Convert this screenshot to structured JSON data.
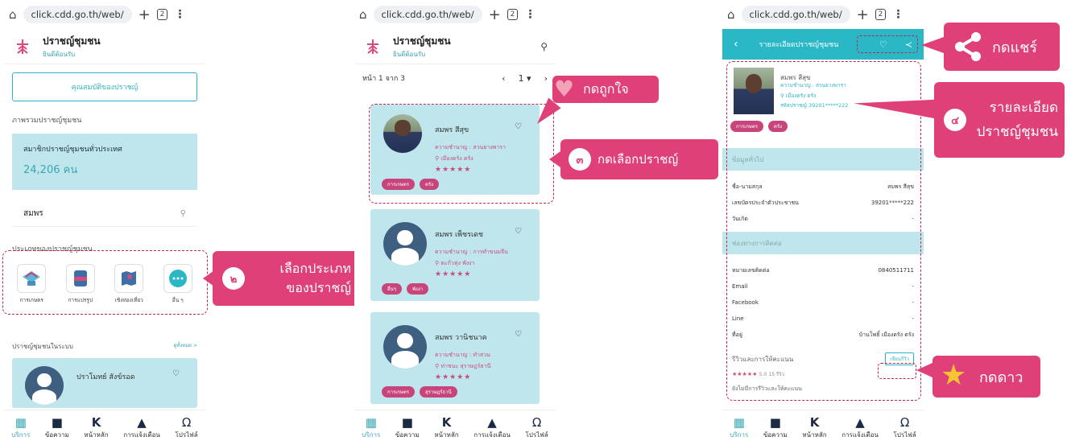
{
  "browser": {
    "url": "click.cdd.go.th/web/",
    "tab_count": "2"
  },
  "app": {
    "title": "ปราชญ์ชุมชน",
    "subtitle": "ยินดีต้อนรับ"
  },
  "nav": {
    "items": [
      "บริการ",
      "ข้อความ",
      "หน้าหลัก",
      "การแจ้งเตือน",
      "โปรไฟล์"
    ]
  },
  "screen1": {
    "qual_button": "คุณสมบัติของปราชญ์",
    "overview_title": "ภาพรวมปราชญ์ชุมชน",
    "stat_label": "สมาชิกปราชญ์ชุมชนทั่วประเทศ",
    "stat_value": "24,206 คน",
    "search_value": "สมพร",
    "types_title": "ประเภทของปราชญ์ชุมชน",
    "categories": [
      "การเกษตร",
      "การแปรรูป",
      "เชิงท่องเที่ยว",
      "อื่น ๆ"
    ],
    "in_system_title": "ปราชญ์ชุมชนในระบบ",
    "see_all": "ดูทั้งหมด >",
    "card_name": "ปราโมทย์ สังข์รอด"
  },
  "screen2": {
    "page_text": "หน้า 1 จาก 3",
    "page_select": "1",
    "cards": [
      {
        "name": "สมพร สีสุข",
        "skill": "ความชำนาญ : สวนยางพารา",
        "location": "เมืองตรัง ตรัง",
        "stars": "★★★★★",
        "tags": [
          "การเกษตร",
          "ตรัง"
        ]
      },
      {
        "name": "สมพร เพ็ชรเดช",
        "skill": "ความชำนาญ : การทำขนมจีน",
        "location": "ตะกั่วทุ่ง พังงา",
        "stars": "★★★★★",
        "tags": [
          "อื่นๆ",
          "พังงา"
        ]
      },
      {
        "name": "สมพร วานิชนาค",
        "skill": "ความชำนาญ : ทำสวน",
        "location": "ท่าชนะ สุราษฎร์ธานี",
        "stars": "★★★★★",
        "tags": [
          "การเกษตร",
          "สุราษฎร์ธานี"
        ]
      }
    ]
  },
  "screen3": {
    "bar_title": "รายละเอียดปราชญ์ชุมชน",
    "name": "สมพร สีสุข",
    "skill": "ความชำนาญ : สวนยางพารา",
    "location": "เมืองตรัง ตรัง",
    "code": "รหัสปราชญ์ 39201*****222",
    "tags": [
      "การเกษตร",
      "ตรัง"
    ],
    "general_title": "ข้อมูลทั่วไป",
    "general": [
      {
        "k": "ชื่อ-นามสกุล",
        "v": "สมพร สีสุข"
      },
      {
        "k": "เลขบัตรประจำตัวประชาชน",
        "v": "39201*****222"
      },
      {
        "k": "วันเกิด",
        "v": "-"
      }
    ],
    "contact_title": "ช่องทางการติดต่อ",
    "contact": [
      {
        "k": "หมายเลขติดต่อ",
        "v": "0840511711"
      },
      {
        "k": "Email",
        "v": "-"
      },
      {
        "k": "Facebook",
        "v": "-"
      },
      {
        "k": "Line",
        "v": "-"
      },
      {
        "k": "ที่อยู่",
        "v": "บ้านโพธิ์ เมืองตรัง ตรัง"
      }
    ],
    "review_title": "รีวิวและการให้คะแนน",
    "review_button": "เขียนรีวิว",
    "rating_stars": "★★★★★",
    "rating_value": "5.0",
    "rating_count": "15 รีวิว",
    "bottom_cut": "ยังไม่มีการรีวิวและให้คะแนน"
  },
  "callouts": {
    "c2_num": "๒",
    "c2_line1": "เลือกประเภท",
    "c2_line2": "ของปราชญ์",
    "like": "กดถูกใจ",
    "c3_num": "๓",
    "c3": "กดเลือกปราชญ์",
    "share": "กดแชร์",
    "c4_num": "๔",
    "c4_line1": "รายละเอียด",
    "c4_line2": "ปราชญ์ชุมชน",
    "star": "กดดาว"
  },
  "colors": {
    "accent": "#2ab7c6",
    "callout": "#de4077",
    "card": "#bfe6ec",
    "tag": "#c8457c"
  }
}
